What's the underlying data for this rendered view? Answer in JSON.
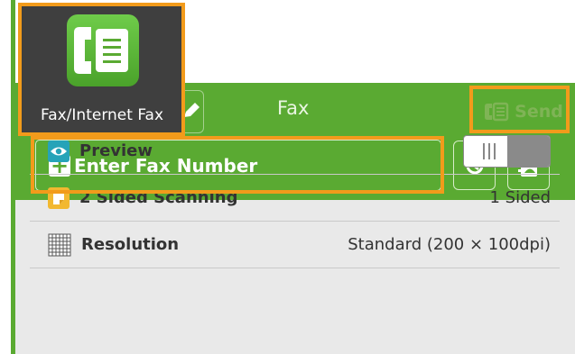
{
  "app_tile": {
    "label": "Fax/Internet Fax",
    "icon": "fax-phone-icon"
  },
  "header": {
    "title": "Fax",
    "send_label": "Send",
    "edit_icon": "pencil-icon"
  },
  "toolbar": {
    "enter_fax_label": "Enter Fax Number",
    "history_icon": "history-icon",
    "address_book_icon": "address-book-icon"
  },
  "options": [
    {
      "label": "Preview",
      "icon": "eye-icon",
      "value": "",
      "control": "toggle"
    },
    {
      "label": "2 Sided Scanning",
      "icon": "page-icon",
      "value": "1 Sided"
    },
    {
      "label": "Resolution",
      "icon": "grid-icon",
      "value": "Standard (200 × 100dpi)"
    }
  ],
  "colors": {
    "accent_green": "#5aaa32",
    "highlight_orange": "#f29b1b",
    "tile_dark": "#3f3f3f"
  }
}
